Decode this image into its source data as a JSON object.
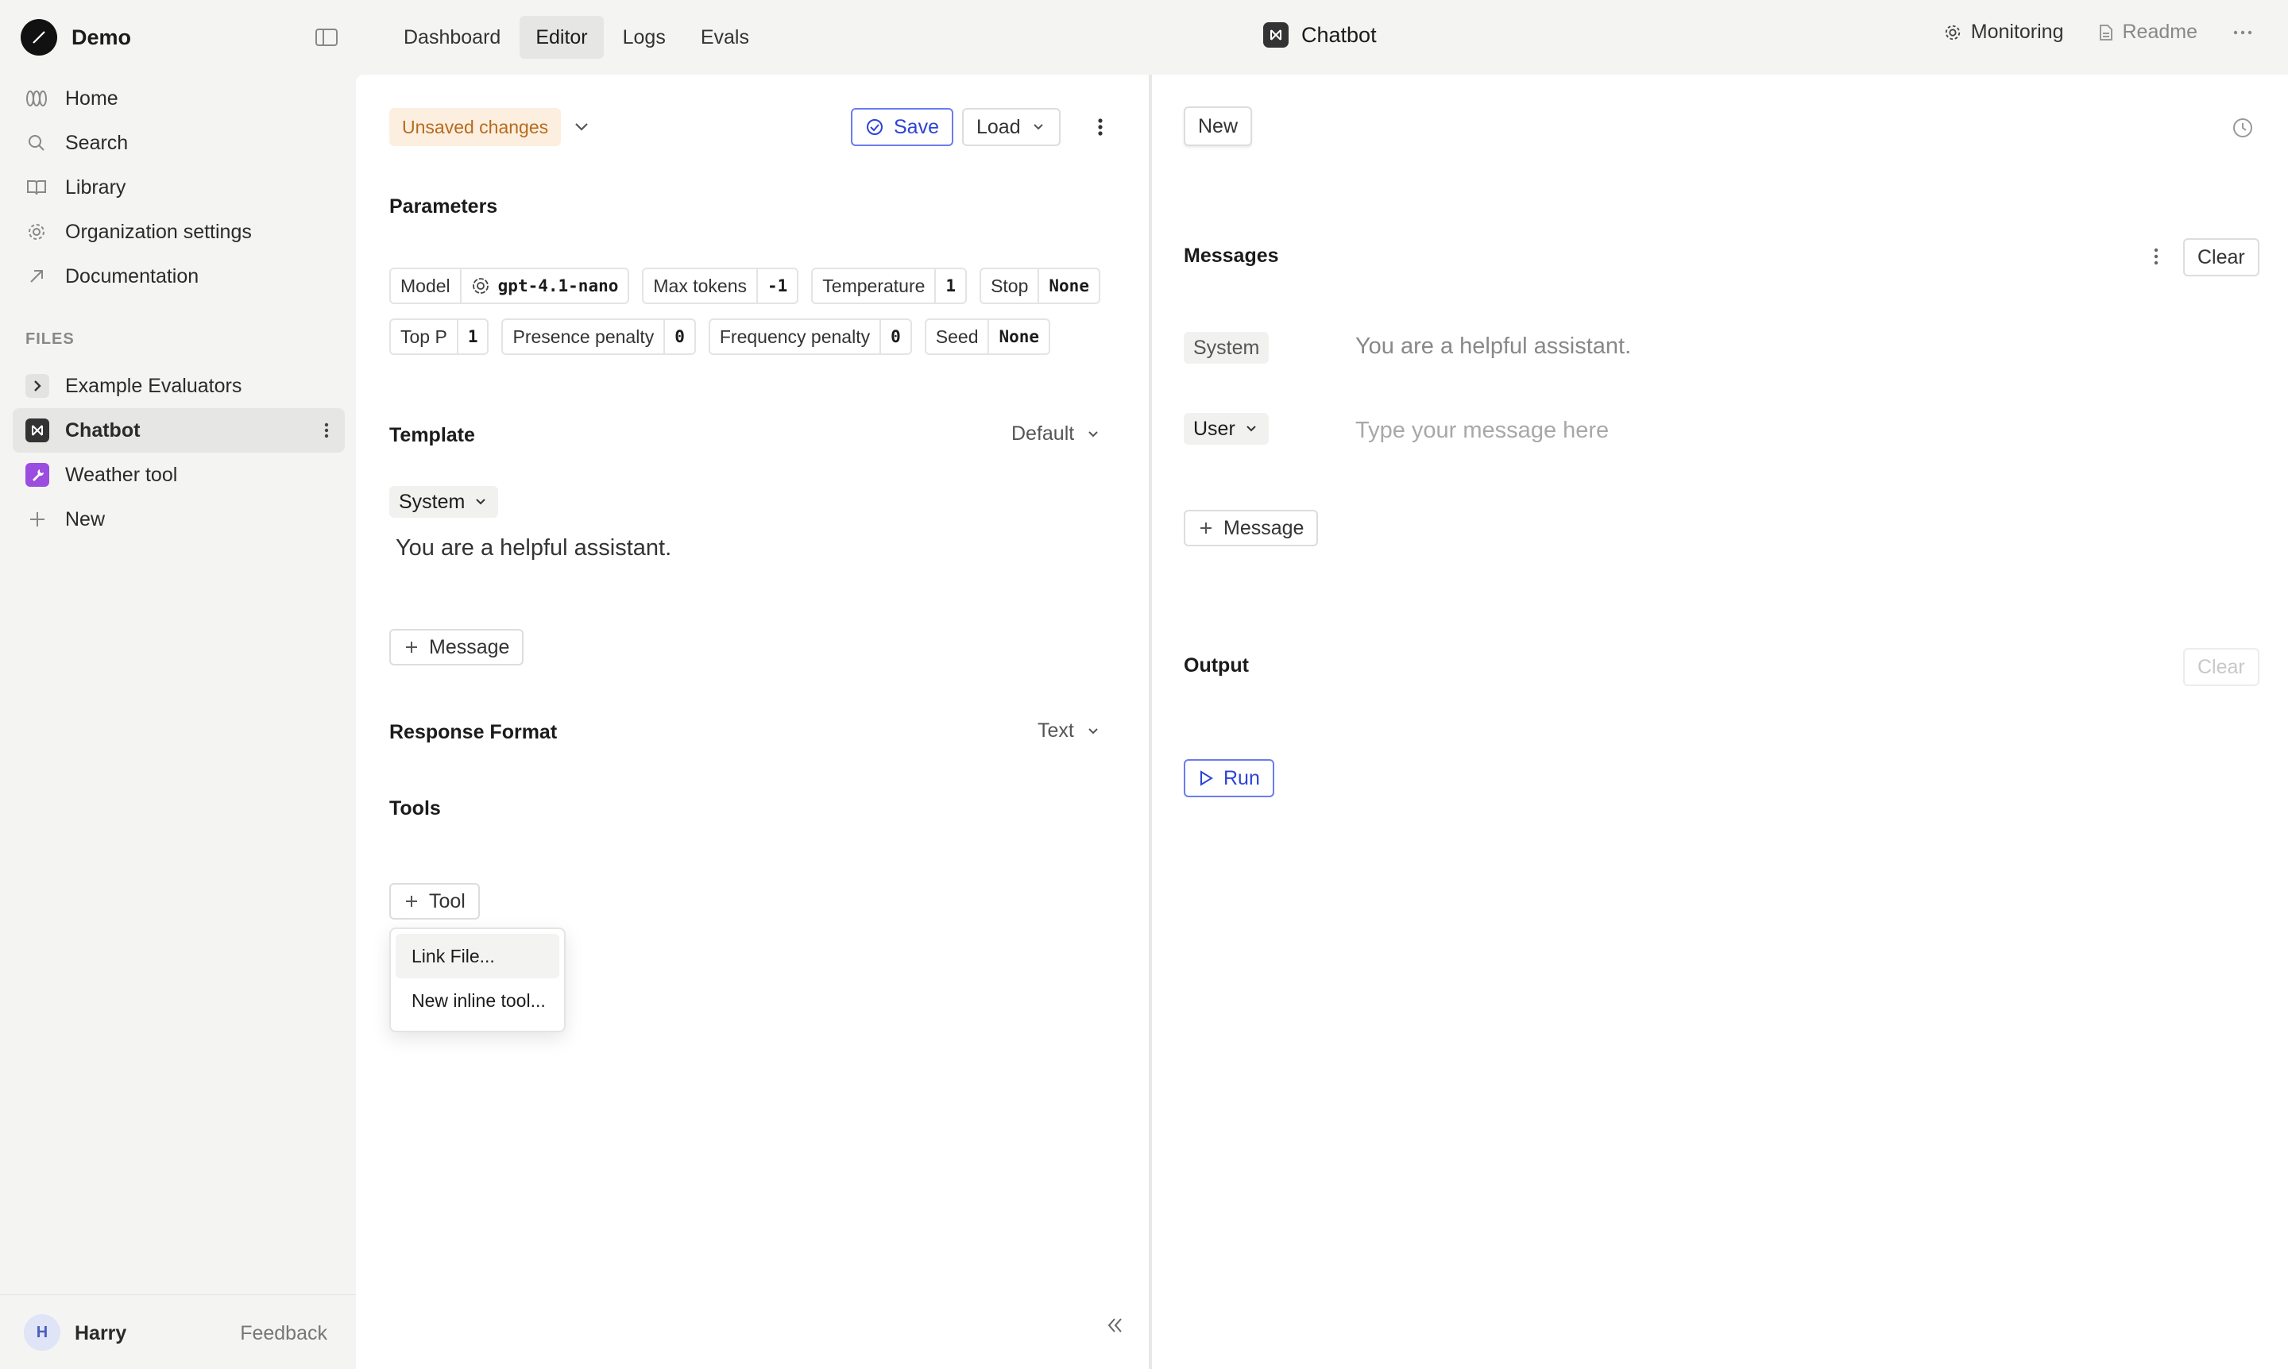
{
  "workspace": {
    "name": "Demo"
  },
  "sidebar": {
    "nav": [
      {
        "label": "Home",
        "icon": "home-icon"
      },
      {
        "label": "Search",
        "icon": "search-icon"
      },
      {
        "label": "Library",
        "icon": "book-icon"
      },
      {
        "label": "Organization settings",
        "icon": "gear-icon"
      },
      {
        "label": "Documentation",
        "icon": "arrow-up-right-icon"
      }
    ],
    "files_label": "FILES",
    "files": [
      {
        "label": "Example Evaluators",
        "icon": "chevron-right-icon"
      },
      {
        "label": "Chatbot",
        "icon": "bot-icon"
      },
      {
        "label": "Weather tool",
        "icon": "wrench-icon"
      },
      {
        "label": "New",
        "icon": "plus-icon"
      }
    ],
    "user": {
      "initial": "H",
      "name": "Harry"
    },
    "feedback": "Feedback"
  },
  "topbar": {
    "tabs": [
      "Dashboard",
      "Editor",
      "Logs",
      "Evals"
    ],
    "active_tab": "Editor",
    "title": "Chatbot",
    "monitoring": "Monitoring",
    "readme": "Readme"
  },
  "editor": {
    "unsaved": "Unsaved changes",
    "save": "Save",
    "load": "Load",
    "parameters_title": "Parameters",
    "params_row1": [
      {
        "key": "Model",
        "value": "gpt-4.1-nano"
      },
      {
        "key": "Max tokens",
        "value": "-1"
      },
      {
        "key": "Temperature",
        "value": "1"
      },
      {
        "key": "Stop",
        "value": "None"
      }
    ],
    "params_row2": [
      {
        "key": "Top P",
        "value": "1"
      },
      {
        "key": "Presence penalty",
        "value": "0"
      },
      {
        "key": "Frequency penalty",
        "value": "0"
      },
      {
        "key": "Seed",
        "value": "None"
      }
    ],
    "template_title": "Template",
    "template_mode": "Default",
    "template_role": "System",
    "template_message": "You are a helpful assistant.",
    "add_message": "Message",
    "response_format_title": "Response Format",
    "response_format": "Text",
    "tools_title": "Tools",
    "add_tool": "Tool",
    "tool_menu": [
      "Link File...",
      "New inline tool..."
    ]
  },
  "chat": {
    "new": "New",
    "messages_title": "Messages",
    "clear": "Clear",
    "system_role": "System",
    "system_message": "You are a helpful assistant.",
    "user_role": "User",
    "user_placeholder": "Type your message here",
    "add_message": "Message",
    "output_title": "Output",
    "output_clear": "Clear",
    "run": "Run"
  },
  "colors": {
    "accent": "#2c43d6",
    "unsaved_bg": "#fcefe0",
    "unsaved_text": "#b86a1c",
    "tool_icon": "#9a4dde"
  }
}
